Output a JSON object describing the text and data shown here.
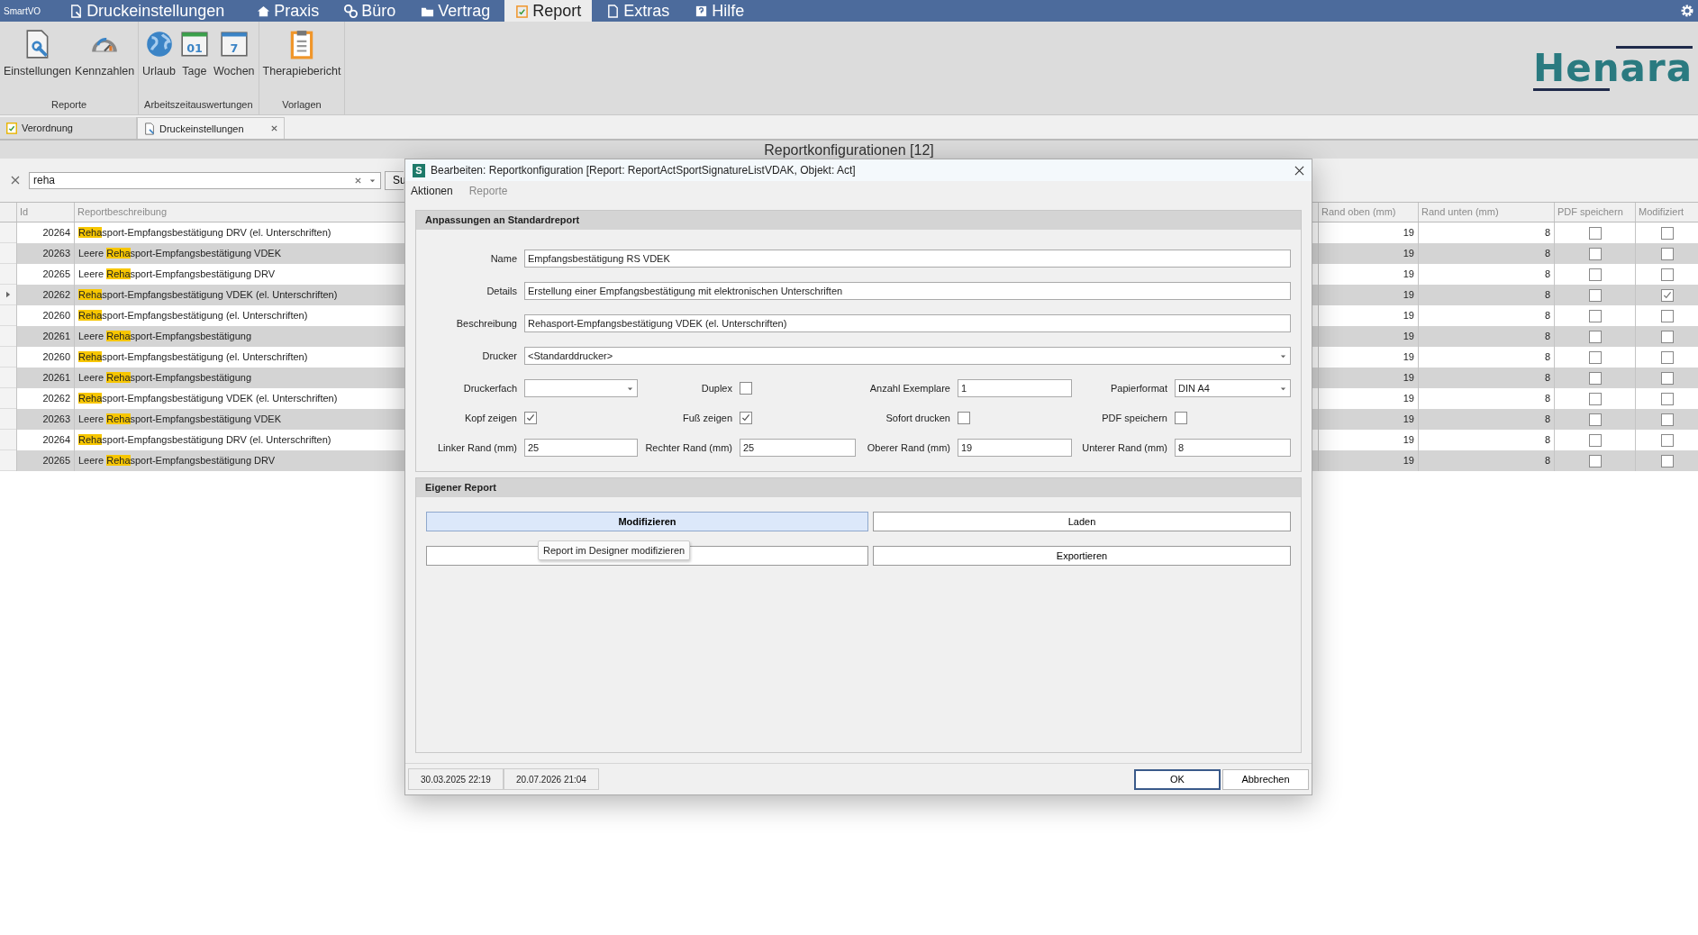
{
  "app_name": "SmartVO",
  "context_title": "Druckeinstellungen",
  "menu_tabs": [
    {
      "label": "Praxis",
      "selected": false
    },
    {
      "label": "Büro",
      "selected": false
    },
    {
      "label": "Vertrag",
      "selected": false
    },
    {
      "label": "Report",
      "selected": true
    },
    {
      "label": "Extras",
      "selected": false
    },
    {
      "label": "Hilfe",
      "selected": false
    }
  ],
  "ribbon": {
    "groups": [
      {
        "label": "Reporte",
        "items": [
          {
            "label": "Einstellungen"
          },
          {
            "label": "Kennzahlen"
          }
        ]
      },
      {
        "label": "Arbeitszeitauswertungen",
        "items": [
          {
            "label": "Urlaub"
          },
          {
            "label": "Tage",
            "icon_text": "01"
          },
          {
            "label": "Wochen",
            "icon_text": "7"
          }
        ]
      },
      {
        "label": "Vorlagen",
        "items": [
          {
            "label": "Therapiebericht"
          }
        ]
      }
    ]
  },
  "logo": "Henara",
  "doc_tabs": [
    {
      "label": "Verordnung",
      "selected": false,
      "closable": false
    },
    {
      "label": "Druckeinstellungen",
      "selected": true,
      "closable": true
    }
  ],
  "page_title": "Reportkonfigurationen [12]",
  "filter": {
    "value": "reha",
    "button": "Su"
  },
  "table": {
    "columns": [
      "Id",
      "Reportbeschreibung",
      "Rand oben (mm)",
      "Rand unten (mm)",
      "PDF speichern",
      "Modifiziert"
    ],
    "rows": [
      {
        "id": "20264",
        "pre": "",
        "match": "Reha",
        "post": "sport-Empfangsbestätigung DRV (el. Unterschriften)",
        "rand_oben": "19",
        "rand_unten": "8",
        "pdf": false,
        "modified": false,
        "selected": false
      },
      {
        "id": "20263",
        "pre": "Leere ",
        "match": "Reha",
        "post": "sport-Empfangsbestätigung VDEK",
        "rand_oben": "19",
        "rand_unten": "8",
        "pdf": false,
        "modified": false,
        "selected": false
      },
      {
        "id": "20265",
        "pre": "Leere ",
        "match": "Reha",
        "post": "sport-Empfangsbestätigung DRV",
        "rand_oben": "19",
        "rand_unten": "8",
        "pdf": false,
        "modified": false,
        "selected": false
      },
      {
        "id": "20262",
        "pre": "",
        "match": "Reha",
        "post": "sport-Empfangsbestätigung VDEK (el. Unterschriften)",
        "rand_oben": "19",
        "rand_unten": "8",
        "pdf": false,
        "modified": true,
        "selected": true
      },
      {
        "id": "20260",
        "pre": "",
        "match": "Reha",
        "post": "sport-Empfangsbestätigung (el. Unterschriften)",
        "rand_oben": "19",
        "rand_unten": "8",
        "pdf": false,
        "modified": false,
        "selected": false
      },
      {
        "id": "20261",
        "pre": "Leere ",
        "match": "Reha",
        "post": "sport-Empfangsbestätigung",
        "rand_oben": "19",
        "rand_unten": "8",
        "pdf": false,
        "modified": false,
        "selected": false
      },
      {
        "id": "20260",
        "pre": "",
        "match": "Reha",
        "post": "sport-Empfangsbestätigung (el. Unterschriften)",
        "rand_oben": "19",
        "rand_unten": "8",
        "pdf": false,
        "modified": false,
        "selected": false
      },
      {
        "id": "20261",
        "pre": "Leere ",
        "match": "Reha",
        "post": "sport-Empfangsbestätigung",
        "rand_oben": "19",
        "rand_unten": "8",
        "pdf": false,
        "modified": false,
        "selected": false
      },
      {
        "id": "20262",
        "pre": "",
        "match": "Reha",
        "post": "sport-Empfangsbestätigung VDEK (el. Unterschriften)",
        "rand_oben": "19",
        "rand_unten": "8",
        "pdf": false,
        "modified": false,
        "selected": false
      },
      {
        "id": "20263",
        "pre": "Leere ",
        "match": "Reha",
        "post": "sport-Empfangsbestätigung VDEK",
        "rand_oben": "19",
        "rand_unten": "8",
        "pdf": false,
        "modified": false,
        "selected": false
      },
      {
        "id": "20264",
        "pre": "",
        "match": "Reha",
        "post": "sport-Empfangsbestätigung DRV (el. Unterschriften)",
        "rand_oben": "19",
        "rand_unten": "8",
        "pdf": false,
        "modified": false,
        "selected": false
      },
      {
        "id": "20265",
        "pre": "Leere ",
        "match": "Reha",
        "post": "sport-Empfangsbestätigung DRV",
        "rand_oben": "19",
        "rand_unten": "8",
        "pdf": false,
        "modified": false,
        "selected": false
      }
    ]
  },
  "dialog": {
    "icon_letter": "S",
    "title": "Bearbeiten: Reportkonfiguration [Report: ReportActSportSignatureListVDAK, Objekt: Act]",
    "menu": [
      {
        "label": "Aktionen",
        "disabled": false
      },
      {
        "label": "Reporte",
        "disabled": true
      }
    ],
    "standard": {
      "heading": "Anpassungen an Standardreport",
      "wide_fields": [
        {
          "label": "Name",
          "kind": "text",
          "value": "Empfangsbestätigung RS VDEK"
        },
        {
          "label": "Details",
          "kind": "text",
          "value": "Erstellung einer Empfangsbestätigung mit elektronischen Unterschriften"
        },
        {
          "label": "Beschreibung",
          "kind": "text",
          "value": "Rehasport-Empfangsbestätigung VDEK (el. Unterschriften)"
        },
        {
          "label": "Drucker",
          "kind": "select",
          "value": "<Standarddrucker>"
        }
      ],
      "fields": [
        {
          "label": "Druckerfach",
          "kind": "select"
        },
        {
          "label": "Duplex",
          "kind": "check",
          "checked": false
        },
        {
          "label": "Anzahl Exemplare",
          "kind": "text",
          "value": "1"
        },
        {
          "label": "Papierformat",
          "kind": "select",
          "value": "DIN A4"
        },
        {
          "label": "Kopf zeigen",
          "kind": "check",
          "checked": true
        },
        {
          "label": "Fuß zeigen",
          "kind": "check",
          "checked": true
        },
        {
          "label": "Sofort drucken",
          "kind": "check",
          "checked": false
        },
        {
          "label": "PDF speichern",
          "kind": "check",
          "checked": false
        },
        {
          "label": "Linker Rand (mm)",
          "kind": "text",
          "value": "25"
        },
        {
          "label": "Rechter Rand (mm)",
          "kind": "text",
          "value": "25"
        },
        {
          "label": "Oberer Rand (mm)",
          "kind": "text",
          "value": "19"
        },
        {
          "label": "Unterer Rand (mm)",
          "kind": "text",
          "value": "8"
        }
      ]
    },
    "own": {
      "heading": "Eigener Report",
      "buttons": [
        {
          "label": "Modifizieren",
          "hover": true
        },
        {
          "label": "Laden",
          "hover": false
        },
        {
          "hover": false
        },
        {
          "label": "Exportieren",
          "hover": false
        }
      ],
      "tooltip": "Report im Designer modifizieren"
    },
    "footer": {
      "dates": [
        "30.03.2025 22:19",
        "20.07.2026 21:04"
      ],
      "buttons": [
        {
          "label": "OK",
          "focused": true
        },
        {
          "label": "Abbrechen",
          "focused": false
        }
      ]
    }
  }
}
